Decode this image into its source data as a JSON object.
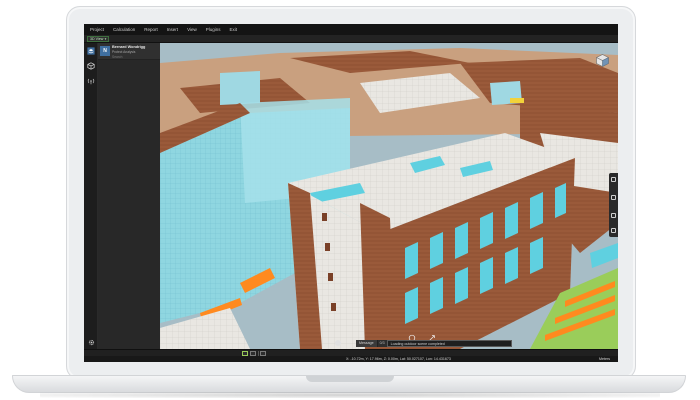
{
  "menu": [
    "Project",
    "Calculation",
    "Report",
    "Insert",
    "View",
    "Plugins",
    "Exit"
  ],
  "view_selector": {
    "label": "3D View"
  },
  "project": {
    "name": "Bernard Wondrigg",
    "subtitle": "Protect Analysis",
    "search_placeholder": "Search"
  },
  "messages": {
    "tab_label": "Message",
    "count": "0/3",
    "text": "Loading outdoor scene completed"
  },
  "status": {
    "coordinates": "X: -10.72m, Y: 17.96m, Z: 0.00m, Lat: 50.027107, Lon: 14.431673",
    "units": "Meters"
  },
  "icons": {
    "rail": [
      "layers-icon",
      "cube-icon",
      "signal-icon",
      "gear-icon"
    ],
    "navigation": "navigation-cube-icon"
  },
  "colors": {
    "brick": "#9a5a3a",
    "panel": "#e8e6e0",
    "glass": "#5fd0e0",
    "accent_green": "#9acd5a",
    "highlight_orange": "#ff8a1f"
  }
}
